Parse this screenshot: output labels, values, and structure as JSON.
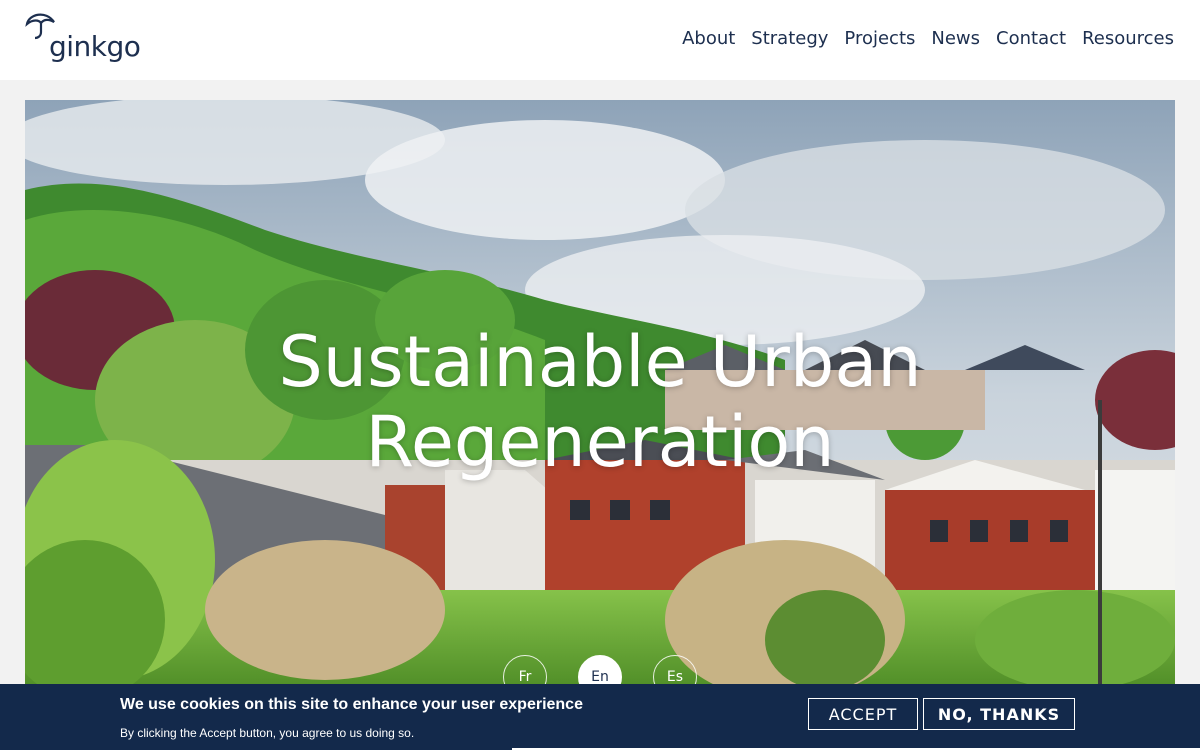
{
  "brand": {
    "name": "ginkgo",
    "color": "#1d2f4f"
  },
  "nav": {
    "items": [
      {
        "label": "About"
      },
      {
        "label": "Strategy"
      },
      {
        "label": "Projects"
      },
      {
        "label": "News"
      },
      {
        "label": "Contact"
      },
      {
        "label": "Resources"
      }
    ]
  },
  "hero": {
    "title_line1": "Sustainable Urban",
    "title_line2": "Regeneration",
    "image_icon": "hero-landscape-photo"
  },
  "languages": [
    {
      "code": "Fr",
      "selected": false
    },
    {
      "code": "En",
      "selected": true
    },
    {
      "code": "Es",
      "selected": false
    }
  ],
  "cookie_banner": {
    "title": "We use cookies on this site to enhance your user experience",
    "subtitle": "By clicking the Accept button, you agree to us doing so.",
    "accept_label": "ACCEPT",
    "decline_label": "NO, THANKS",
    "background_color": "#13294b"
  }
}
